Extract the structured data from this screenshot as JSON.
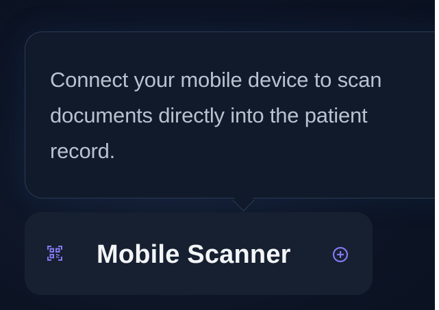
{
  "tooltip": {
    "text": "Connect your mobile device to scan documents directly into the patient record."
  },
  "scanner": {
    "label": "Mobile Scanner",
    "icon": "qr-code-scan-icon",
    "action_icon": "add-circle-icon"
  },
  "colors": {
    "background": "#0d1526",
    "tooltip_background": "#111a2b",
    "tooltip_border": "#2c3a52",
    "button_background": "#172031",
    "accent": "#8479f2",
    "label": "#f3f5f8",
    "tooltip_text": "#b9c2cf"
  }
}
